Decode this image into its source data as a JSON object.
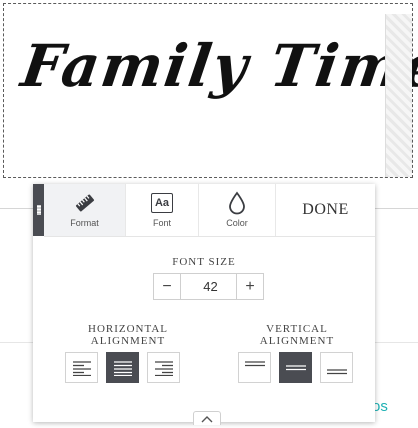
{
  "canvas": {
    "headline": "Family Time",
    "link_text": "os"
  },
  "panel": {
    "tabs": [
      {
        "label": "Format",
        "icon": "ruler-icon",
        "active": true
      },
      {
        "label": "Font",
        "icon": "font-aa-icon",
        "active": false
      },
      {
        "label": "Color",
        "icon": "droplet-icon",
        "active": false
      }
    ],
    "font_icon_text": "Aa",
    "done_label": "DONE",
    "font_size": {
      "title": "FONT SIZE",
      "value": "42",
      "minus": "−",
      "plus": "+"
    },
    "horizontal_alignment": {
      "title": "HORIZONTAL ALIGNMENT",
      "options": [
        "left-align-icon",
        "justify-align-icon",
        "right-align-icon"
      ],
      "selected": "justify"
    },
    "vertical_alignment": {
      "title": "VERTICAL ALIGNMENT",
      "options": [
        "top-align-icon",
        "middle-align-icon",
        "bottom-align-icon"
      ],
      "selected": "middle"
    }
  },
  "colors": {
    "accent_dark": "#4a4c52",
    "link_teal": "#1fb1b4"
  }
}
